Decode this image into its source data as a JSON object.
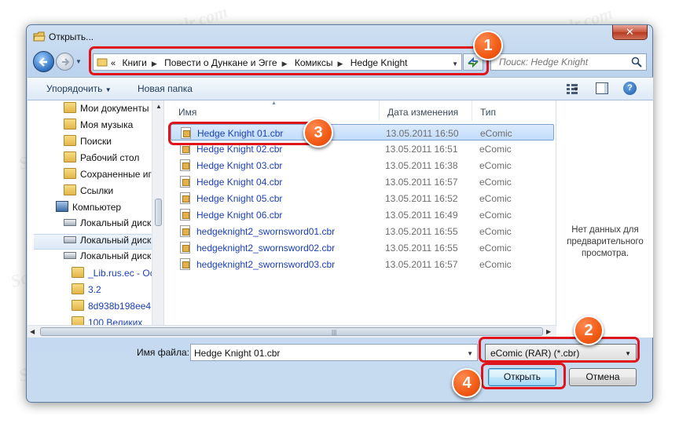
{
  "window": {
    "title": "Открыть..."
  },
  "address": {
    "chevron": "«",
    "segments": [
      "Книги",
      "Повести о Дункане и Эгге",
      "Комиксы",
      "Hedge Knight"
    ]
  },
  "search": {
    "placeholder": "Поиск: Hedge Knight"
  },
  "toolbar": {
    "organize_label": "Упорядочить",
    "new_folder_label": "Новая папка"
  },
  "nav": {
    "items": [
      {
        "label": "Мои документы",
        "icon": "folder-icon"
      },
      {
        "label": "Моя музыка",
        "icon": "folder-icon"
      },
      {
        "label": "Поиски",
        "icon": "folder-icon"
      },
      {
        "label": "Рабочий стол",
        "icon": "folder-icon"
      },
      {
        "label": "Сохраненные иг",
        "icon": "folder-icon"
      },
      {
        "label": "Ссылки",
        "icon": "folder-icon"
      },
      {
        "label": "Компьютер",
        "icon": "computer-icon"
      },
      {
        "label": "Локальный диск",
        "icon": "drive-icon"
      },
      {
        "label": "Локальный диск",
        "icon": "drive-icon"
      },
      {
        "label": "Локальный диск",
        "icon": "drive-icon"
      },
      {
        "label": "_Lib.rus.ec - Oc",
        "icon": "folder-icon"
      },
      {
        "label": "3.2",
        "icon": "folder-icon"
      },
      {
        "label": "8d938b198ee41",
        "icon": "folder-icon"
      },
      {
        "label": "100 Великих",
        "icon": "folder-icon"
      }
    ]
  },
  "columns": {
    "name": "Имя",
    "date": "Дата изменения",
    "type": "Тип"
  },
  "files": [
    {
      "name": "Hedge Knight 01.cbr",
      "date": "13.05.2011 16:50",
      "type": "eComic"
    },
    {
      "name": "Hedge Knight 02.cbr",
      "date": "13.05.2011 16:51",
      "type": "eComic"
    },
    {
      "name": "Hedge Knight 03.cbr",
      "date": "13.05.2011 16:38",
      "type": "eComic"
    },
    {
      "name": "Hedge Knight 04.cbr",
      "date": "13.05.2011 16:57",
      "type": "eComic"
    },
    {
      "name": "Hedge Knight 05.cbr",
      "date": "13.05.2011 16:52",
      "type": "eComic"
    },
    {
      "name": "Hedge Knight 06.cbr",
      "date": "13.05.2011 16:49",
      "type": "eComic"
    },
    {
      "name": "hedgeknight2_swornsword01.cbr",
      "date": "13.05.2011 16:55",
      "type": "eComic"
    },
    {
      "name": "hedgeknight2_swornsword02.cbr",
      "date": "13.05.2011 16:55",
      "type": "eComic"
    },
    {
      "name": "hedgeknight2_swornsword03.cbr",
      "date": "13.05.2011 16:57",
      "type": "eComic"
    }
  ],
  "preview": {
    "text": "Нет данных для предварительного просмотра."
  },
  "bottom": {
    "filename_label": "Имя файла:",
    "filename_value": "Hedge Knight 01.cbr",
    "filter_value": "eComic (RAR) (*.cbr)",
    "open_label": "Открыть",
    "cancel_label": "Отмена"
  },
  "annotations": [
    "1",
    "2",
    "3",
    "4"
  ],
  "watermark": "Sortingpersolr.com",
  "colors": {
    "callout": "#e0141b",
    "badge": "#f25a14",
    "link": "#1a3fb8"
  }
}
